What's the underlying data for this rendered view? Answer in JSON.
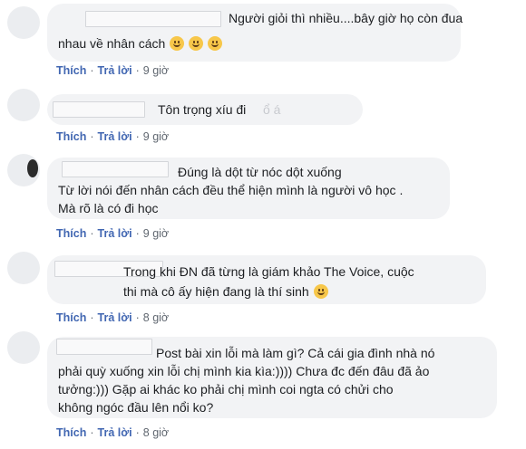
{
  "comments": [
    {
      "lines": [
        "Người giỏi thì nhiều....bây giờ họ còn đua",
        "nhau về nhân cách"
      ],
      "emojis": [
        "grinning-sweat-emoji",
        "grinning-sweat-emoji",
        "grinning-sweat-emoji"
      ],
      "like_label": "Thích",
      "reply_label": "Trả lời",
      "time": "9 giờ"
    },
    {
      "lines": [
        "Tôn trọng xíu đi"
      ],
      "faded_text": "ổ    á",
      "like_label": "Thích",
      "reply_label": "Trả lời",
      "time": "9 giờ"
    },
    {
      "lines": [
        "Đúng là dột từ nóc dột xuống",
        "Từ lời nói đến nhân cách đều thể hiện mình là người vô học .",
        "Mà rõ là có đi học"
      ],
      "like_label": "Thích",
      "reply_label": "Trả lời",
      "time": "9 giờ"
    },
    {
      "lines": [
        "Trong khi ĐN đã từng là giám khảo The Voice, cuộc",
        "thi mà cô ấy hiện đang là thí sinh"
      ],
      "emojis": [
        "smile-emoji"
      ],
      "like_label": "Thích",
      "reply_label": "Trả lời",
      "time": "8 giờ"
    },
    {
      "lines": [
        "Post bài xin lỗi mà làm gì? Cả cái gia đình nhà nó",
        "phải quỳ xuống xin lỗi chị mình kia kìa:)))) Chưa đc đến đâu đã ảo",
        "tưởng:))) Gặp ai khác ko phải chị mình coi ngta có chửi cho",
        "không ngóc đầu lên nổi ko?"
      ],
      "like_label": "Thích",
      "reply_label": "Trả lời",
      "time": "8 giờ"
    }
  ],
  "separator": "·"
}
